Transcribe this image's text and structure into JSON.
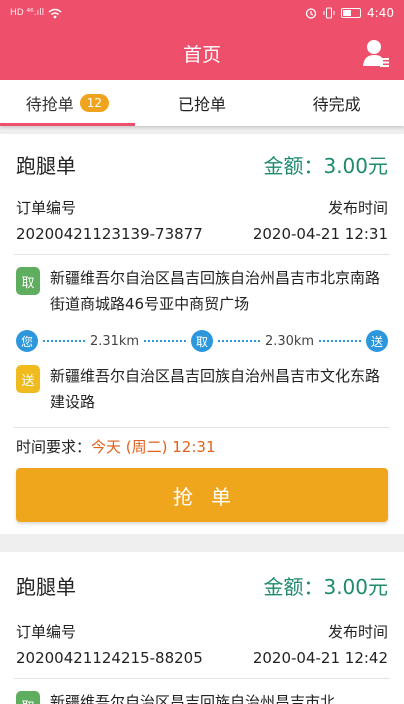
{
  "status_bar": {
    "signal": "HD ⁴⁶.ıll",
    "time": "4:40"
  },
  "header": {
    "title": "首页"
  },
  "tabs": [
    {
      "label": "待抢单",
      "badge": "12"
    },
    {
      "label": "已抢单"
    },
    {
      "label": "待完成"
    }
  ],
  "orders": [
    {
      "title": "跑腿单",
      "amount": "金额：3.00元",
      "order_no_label": "订单编号",
      "order_no": "20200421123139-73877",
      "pub_label": "发布时间",
      "pub_time": "2020-04-21 12:31",
      "pickup_tag": "取",
      "pickup_addr": "新疆维吾尔自治区昌吉回族自治州昌吉市北京南路街道商城路46号亚中商贸广场",
      "route": {
        "you": "您",
        "dist1": "2.31km",
        "mid": "取",
        "dist2": "2.30km",
        "dest": "送"
      },
      "deliver_tag": "送",
      "deliver_addr": "新疆维吾尔自治区昌吉回族自治州昌吉市文化东路建设路",
      "time_label": "时间要求：",
      "time_value": "今天 (周二) 12:31",
      "grab_label": "抢单"
    },
    {
      "title": "跑腿单",
      "amount": "金额：3.00元",
      "order_no_label": "订单编号",
      "order_no": "20200421124215-88205",
      "pub_label": "发布时间",
      "pub_time": "2020-04-21 12:42",
      "pickup_tag": "取",
      "pickup_addr": "新疆维吾尔自治区昌吉回族自治州昌吉市北"
    }
  ]
}
